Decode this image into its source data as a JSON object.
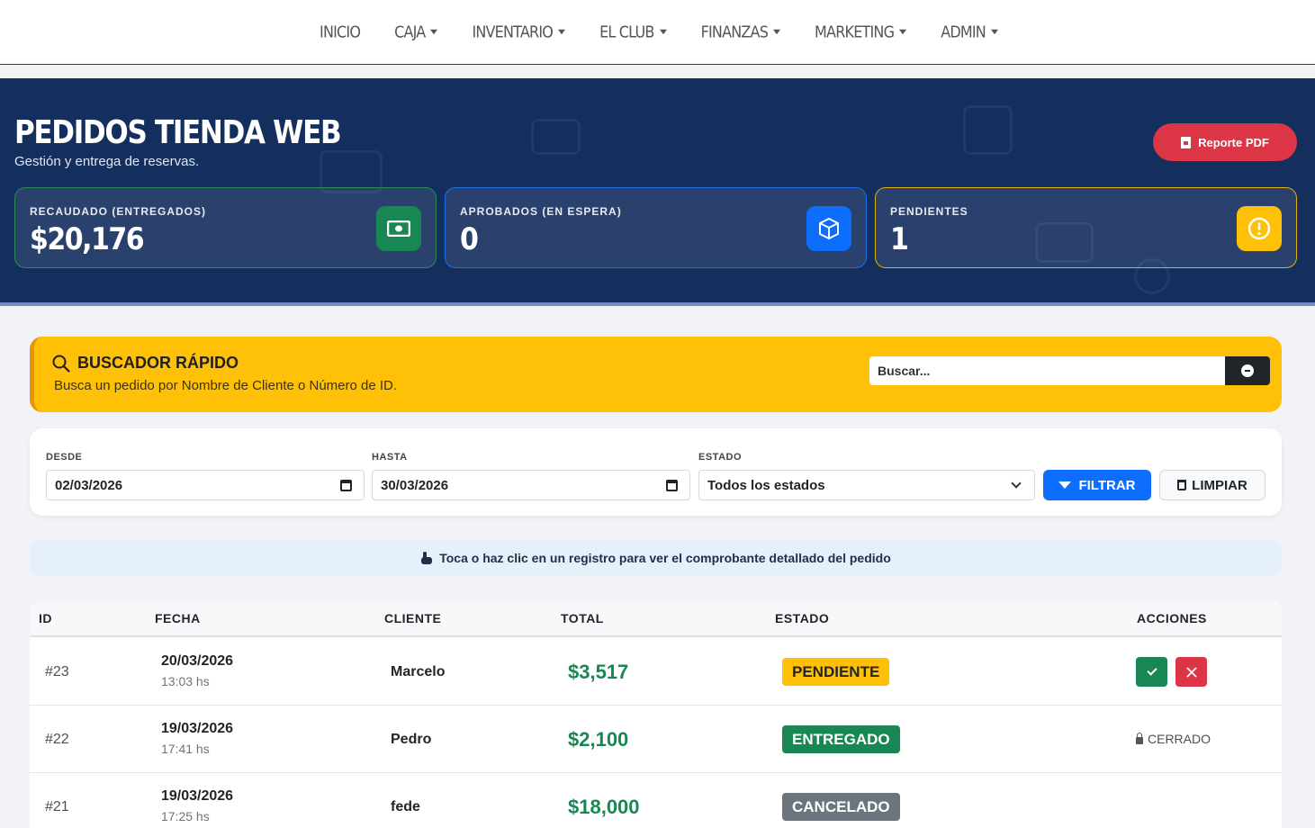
{
  "nav": {
    "items": [
      {
        "label": "INICIO",
        "dropdown": false
      },
      {
        "label": "CAJA",
        "dropdown": true
      },
      {
        "label": "INVENTARIO",
        "dropdown": true
      },
      {
        "label": "EL CLUB",
        "dropdown": true
      },
      {
        "label": "FINANZAS",
        "dropdown": true
      },
      {
        "label": "MARKETING",
        "dropdown": true
      },
      {
        "label": "ADMIN",
        "dropdown": true
      }
    ]
  },
  "hero": {
    "title": "PEDIDOS TIENDA WEB",
    "subtitle": "Gestión y entrega de reservas.",
    "pdf_button": "Reporte PDF",
    "stats": [
      {
        "label": "RECAUDADO (ENTREGADOS)",
        "value": "$20,176",
        "icon": "money-icon",
        "color": "#198754"
      },
      {
        "label": "APROBADOS (EN ESPERA)",
        "value": "0",
        "icon": "box-icon",
        "color": "#0d6efd"
      },
      {
        "label": "PENDIENTES",
        "value": "1",
        "icon": "alert-icon",
        "color": "#ffc107"
      }
    ]
  },
  "search": {
    "title": "BUSCADOR RÁPIDO",
    "description": "Busca un pedido por Nombre de Cliente o Número de ID.",
    "placeholder": "Buscar..."
  },
  "filters": {
    "desde_label": "DESDE",
    "desde_value": "02/03/2026",
    "hasta_label": "HASTA",
    "hasta_value": "30/03/2026",
    "estado_label": "ESTADO",
    "estado_value": "Todos los estados",
    "filtrar_label": "FILTRAR",
    "limpiar_label": "LIMPIAR"
  },
  "hint": "Toca o haz clic en un registro para ver el comprobante detallado del pedido",
  "table": {
    "headers": {
      "id": "ID",
      "fecha": "FECHA",
      "cliente": "CLIENTE",
      "total": "TOTAL",
      "estado": "ESTADO",
      "acciones": "ACCIONES"
    },
    "closed_label": "CERRADO",
    "rows": [
      {
        "id": "#23",
        "date": "20/03/2026",
        "time": "13:03 hs",
        "client": "Marcelo",
        "total": "$3,517",
        "status": "PENDIENTE"
      },
      {
        "id": "#22",
        "date": "19/03/2026",
        "time": "17:41 hs",
        "client": "Pedro",
        "total": "$2,100",
        "status": "ENTREGADO"
      },
      {
        "id": "#21",
        "date": "19/03/2026",
        "time": "17:25 hs",
        "client": "fede",
        "total": "$18,000",
        "status": "CANCELADO"
      }
    ]
  },
  "colors": {
    "navy": "#142f5e",
    "yellow": "#ffc107",
    "green": "#198754",
    "red": "#dc3545",
    "blue": "#0d6efd"
  }
}
